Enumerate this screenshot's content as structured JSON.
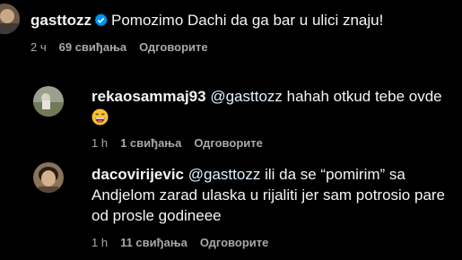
{
  "comments": [
    {
      "username": "gasttozz",
      "verified": true,
      "mention": "",
      "text": "Pomozimo Dachi da ga bar u ulici znaju!",
      "time": "2 ч",
      "likes": "69 свиђања",
      "reply": "Одговорите"
    },
    {
      "username": "rekaosammaj93",
      "mention": "@gasttozz",
      "text": "hahah otkud tebe ovde",
      "emoji": "grinning-face-emoji",
      "time": "1 h",
      "likes": "1 свиђања",
      "reply": "Одговорите"
    },
    {
      "username": "dacovirijevic",
      "mention": "@gasttozz",
      "text_line1": "ili da se “pomirim” sa",
      "text_line2": "Andjelom zarad ulaska u rijaliti jer sam potrosio pare",
      "text_line3": "od prosle godineee",
      "time": "1 h",
      "likes": "11 свиђања",
      "reply": "Одговорите"
    }
  ],
  "colors": {
    "background": "#000000",
    "text": "#f5f5f5",
    "secondary": "#a8a8a8",
    "mention": "#e0f1ff",
    "verified": "#0095f6"
  }
}
